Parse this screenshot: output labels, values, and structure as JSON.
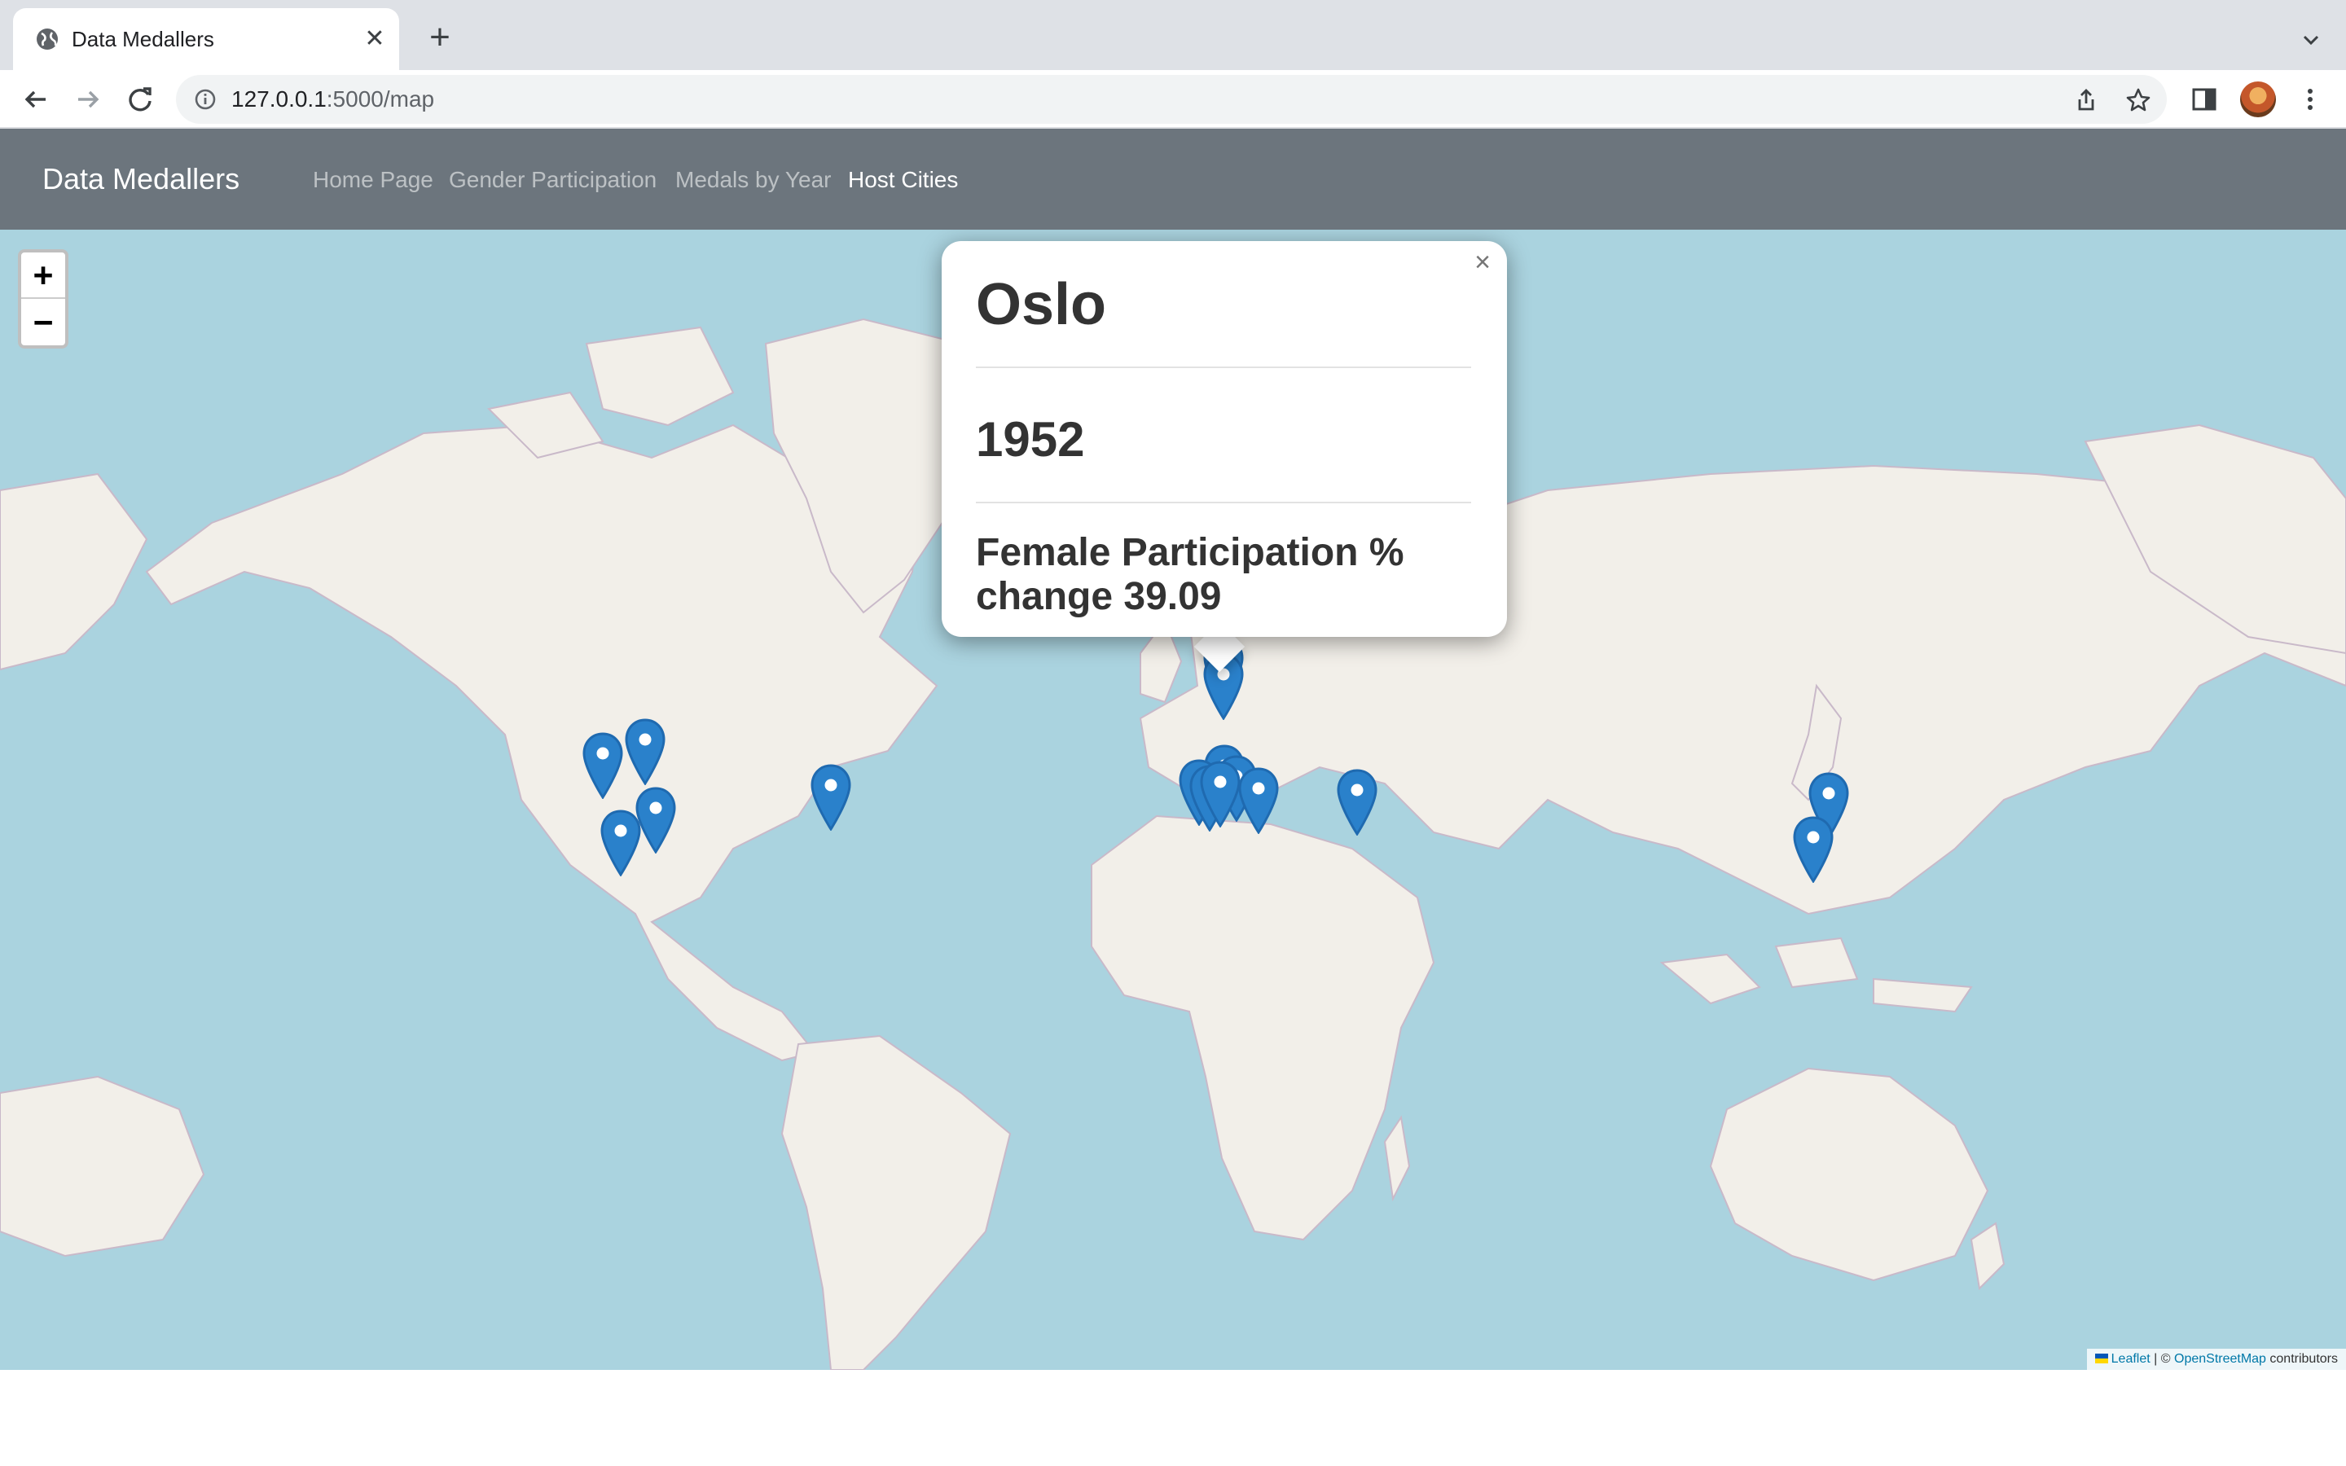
{
  "browser": {
    "tab_title": "Data Medallers",
    "url_host": "127.0.0.1",
    "url_path": ":5000/map",
    "icons": [
      "globe-icon",
      "close-icon",
      "plus-icon",
      "chevron-down-icon",
      "back-arrow-icon",
      "forward-arrow-icon",
      "reload-icon",
      "info-icon",
      "share-icon",
      "star-icon",
      "side-panel-icon",
      "kebab-menu-icon"
    ]
  },
  "navbar": {
    "brand": "Data Medallers",
    "links": [
      {
        "label": "Home Page",
        "active": false
      },
      {
        "label": "Gender Participation",
        "active": false
      },
      {
        "label": "Medals by Year",
        "active": false
      },
      {
        "label": "Host Cities",
        "active": true
      }
    ],
    "background": "#6c757d"
  },
  "map": {
    "zoom_in": "+",
    "zoom_out": "−",
    "popup": {
      "close": "×",
      "city": "Oslo",
      "year": "1952",
      "stat": "Female Participation % change 39.09"
    },
    "attribution": {
      "leaflet": "Leaflet",
      "separator": "| ©",
      "osm": "OpenStreetMap",
      "suffix": "contributors"
    },
    "colors": {
      "water": "#aad3df",
      "land": "#f2efe9",
      "marker": "#2a81cb"
    }
  }
}
